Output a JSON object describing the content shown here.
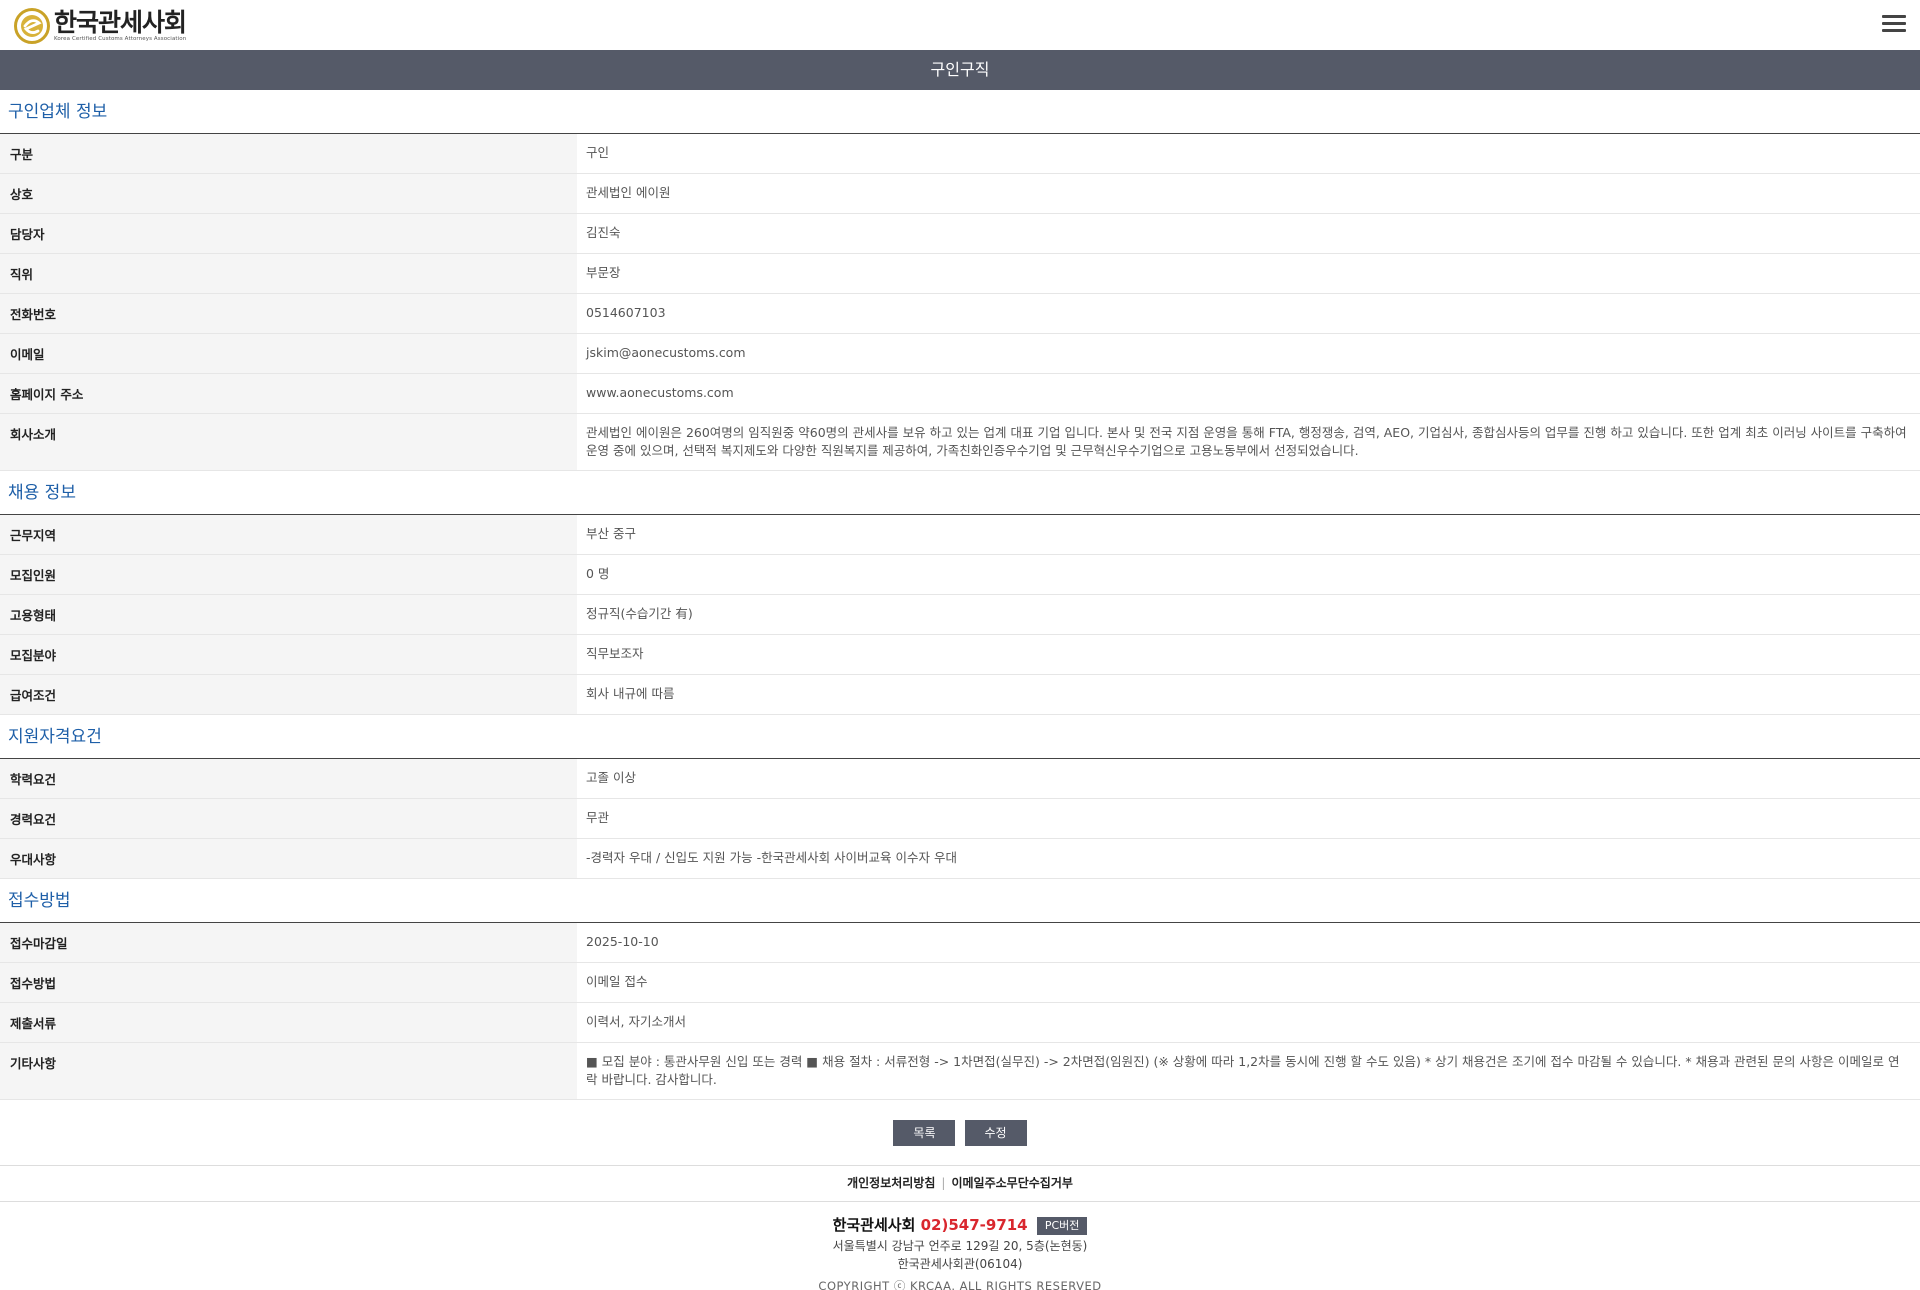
{
  "header": {
    "logo_text": "한국관세사회",
    "logo_sub": "Korea Certified Customs Attorneys Association"
  },
  "title_bar": "구인구직",
  "sections": [
    {
      "title": "구인업체 정보",
      "rows": [
        {
          "label": "구분",
          "value": "구인"
        },
        {
          "label": "상호",
          "value": "관세법인 에이원"
        },
        {
          "label": "담당자",
          "value": "김진숙"
        },
        {
          "label": "직위",
          "value": "부문장"
        },
        {
          "label": "전화번호",
          "value": "0514607103"
        },
        {
          "label": "이메일",
          "value": "jskim@aonecustoms.com"
        },
        {
          "label": "홈페이지 주소",
          "value": "www.aonecustoms.com"
        },
        {
          "label": "회사소개",
          "value": "관세법인 에이원은 260여명의 임직원중 약60명의 관세사를 보유 하고 있는 업계 대표 기업 입니다. 본사 및 전국 지점 운영을 통해 FTA, 행정쟁송, 검역, AEO, 기업심사, 종합심사등의 업무를 진행 하고 있습니다. 또한 업계 최초 이러닝 사이트를 구축하여 운영 중에 있으며, 선택적 복지제도와 다양한 직원복지를 제공하여, 가족친화인증우수기업 및 근무혁신우수기업으로 고용노동부에서 선정되었습니다."
        }
      ]
    },
    {
      "title": "채용 정보",
      "rows": [
        {
          "label": "근무지역",
          "value": "부산 중구"
        },
        {
          "label": "모집인원",
          "value": "0 명"
        },
        {
          "label": "고용형태",
          "value": "정규직(수습기간 有)"
        },
        {
          "label": "모집분야",
          "value": "직무보조자"
        },
        {
          "label": "급여조건",
          "value": "회사 내규에 따름"
        }
      ]
    },
    {
      "title": "지원자격요건",
      "rows": [
        {
          "label": "학력요건",
          "value": "고졸 이상"
        },
        {
          "label": "경력요건",
          "value": "무관"
        },
        {
          "label": "우대사항",
          "value": "-경력자 우대 / 신입도 지원 가능 -한국관세사회 사이버교육 이수자 우대"
        }
      ]
    },
    {
      "title": "접수방법",
      "rows": [
        {
          "label": "접수마감일",
          "value": "2025-10-10"
        },
        {
          "label": "접수방법",
          "value": "이메일 접수"
        },
        {
          "label": "제출서류",
          "value": "이력서, 자기소개서"
        },
        {
          "label": "기타사항",
          "value": "■ 모집 분야 : 통관사무원 신입 또는 경력 ■ 채용 절차 : 서류전형 -> 1차면접(실무진) -> 2차면접(임원진) (※ 상황에 따라 1,2차를 동시에 진행 할 수도 있음) * 상기 채용건은 조기에 접수 마감될 수 있습니다. * 채용과 관련된 문의 사항은 이메일로 연락 바랍니다. 감사합니다."
        }
      ]
    }
  ],
  "buttons": {
    "list": "목록",
    "edit": "수정"
  },
  "footer": {
    "link_privacy": "개인정보처리방침",
    "link_email": "이메일주소무단수집거부",
    "org_name": "한국관세사회",
    "phone": "02)547-9714",
    "pc_version": "PC버전",
    "address1": "서울특별시 강남구 언주로 129길 20, 5층(논현동)",
    "address2": "한국관세사회관(06104)",
    "copyright": "COPYRIGHT ⓒ KRCAA. ALL RIGHTS RESERVED"
  }
}
